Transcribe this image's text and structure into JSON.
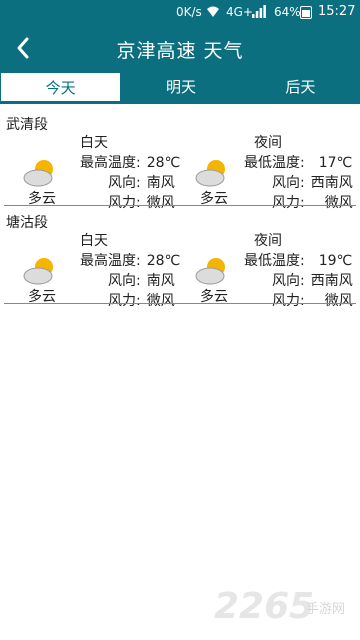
{
  "status_bar": {
    "network_speed": "0K/s",
    "signal": "4G+",
    "battery": "64%",
    "time": "15:27"
  },
  "header": {
    "title": "京津高速 天气",
    "back_icon": "back-arrow-icon"
  },
  "tabs": [
    {
      "label": "今天",
      "active": true
    },
    {
      "label": "明天",
      "active": false
    },
    {
      "label": "后天",
      "active": false
    }
  ],
  "sections": [
    {
      "name": "武清段",
      "day": {
        "period": "白天",
        "condition": "多云",
        "temp_label": "最高温度:",
        "temp": "28℃",
        "wind_dir_label": "风向:",
        "wind_dir": "南风",
        "wind_power_label": "风力:",
        "wind_power": "微风"
      },
      "night": {
        "period": "夜间",
        "condition": "多云",
        "temp_label": "最低温度:",
        "temp": "17℃",
        "wind_dir_label": "风向:",
        "wind_dir": "西南风",
        "wind_power_label": "风力:",
        "wind_power": "微风"
      }
    },
    {
      "name": "塘沽段",
      "day": {
        "period": "白天",
        "condition": "多云",
        "temp_label": "最高温度:",
        "temp": "28℃",
        "wind_dir_label": "风向:",
        "wind_dir": "南风",
        "wind_power_label": "风力:",
        "wind_power": "微风"
      },
      "night": {
        "period": "夜间",
        "condition": "多云",
        "temp_label": "最低温度:",
        "temp": "19℃",
        "wind_dir_label": "风向:",
        "wind_dir": "西南风",
        "wind_power_label": "风力:",
        "wind_power": "微风"
      }
    }
  ],
  "watermark": {
    "number": "2265",
    "site": "手游网"
  },
  "colors": {
    "accent": "#0b6f7f",
    "sun": "#f5b400",
    "cloud": "#d9d9d9"
  }
}
